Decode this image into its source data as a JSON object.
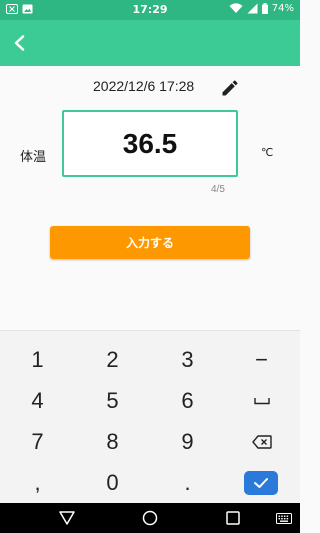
{
  "status_bar": {
    "time": "17:29",
    "battery": "74%",
    "icons": [
      "close-box-icon",
      "image-icon",
      "wifi-icon",
      "signal-icon",
      "battery-icon"
    ]
  },
  "app_bar": {
    "icons": [
      "back-arrow-icon"
    ],
    "color": "#3ccb95"
  },
  "form": {
    "datetime": "2022/12/6 17:28",
    "temp_label": "体温",
    "temp_value": "36.5",
    "temp_unit": "℃",
    "char_count": "4/5",
    "submit_label": "入力する"
  },
  "keyboard": {
    "keys": [
      "1",
      "2",
      "3",
      "−",
      "4",
      "5",
      "6",
      "␣",
      "7",
      "8",
      "9",
      "⌫",
      ",",
      "0",
      ".",
      "✓"
    ],
    "icons": [
      "space-icon",
      "backspace-icon",
      "check-icon"
    ]
  },
  "nav_bar": {
    "icons": [
      "back-triangle-icon",
      "home-circle-icon",
      "recents-square-icon",
      "keyboard-icon"
    ]
  },
  "colors": {
    "status_bar": "#2eb783",
    "accent": "#3ccb95",
    "submit": "#fe9800",
    "done_key": "#2b79d8"
  }
}
